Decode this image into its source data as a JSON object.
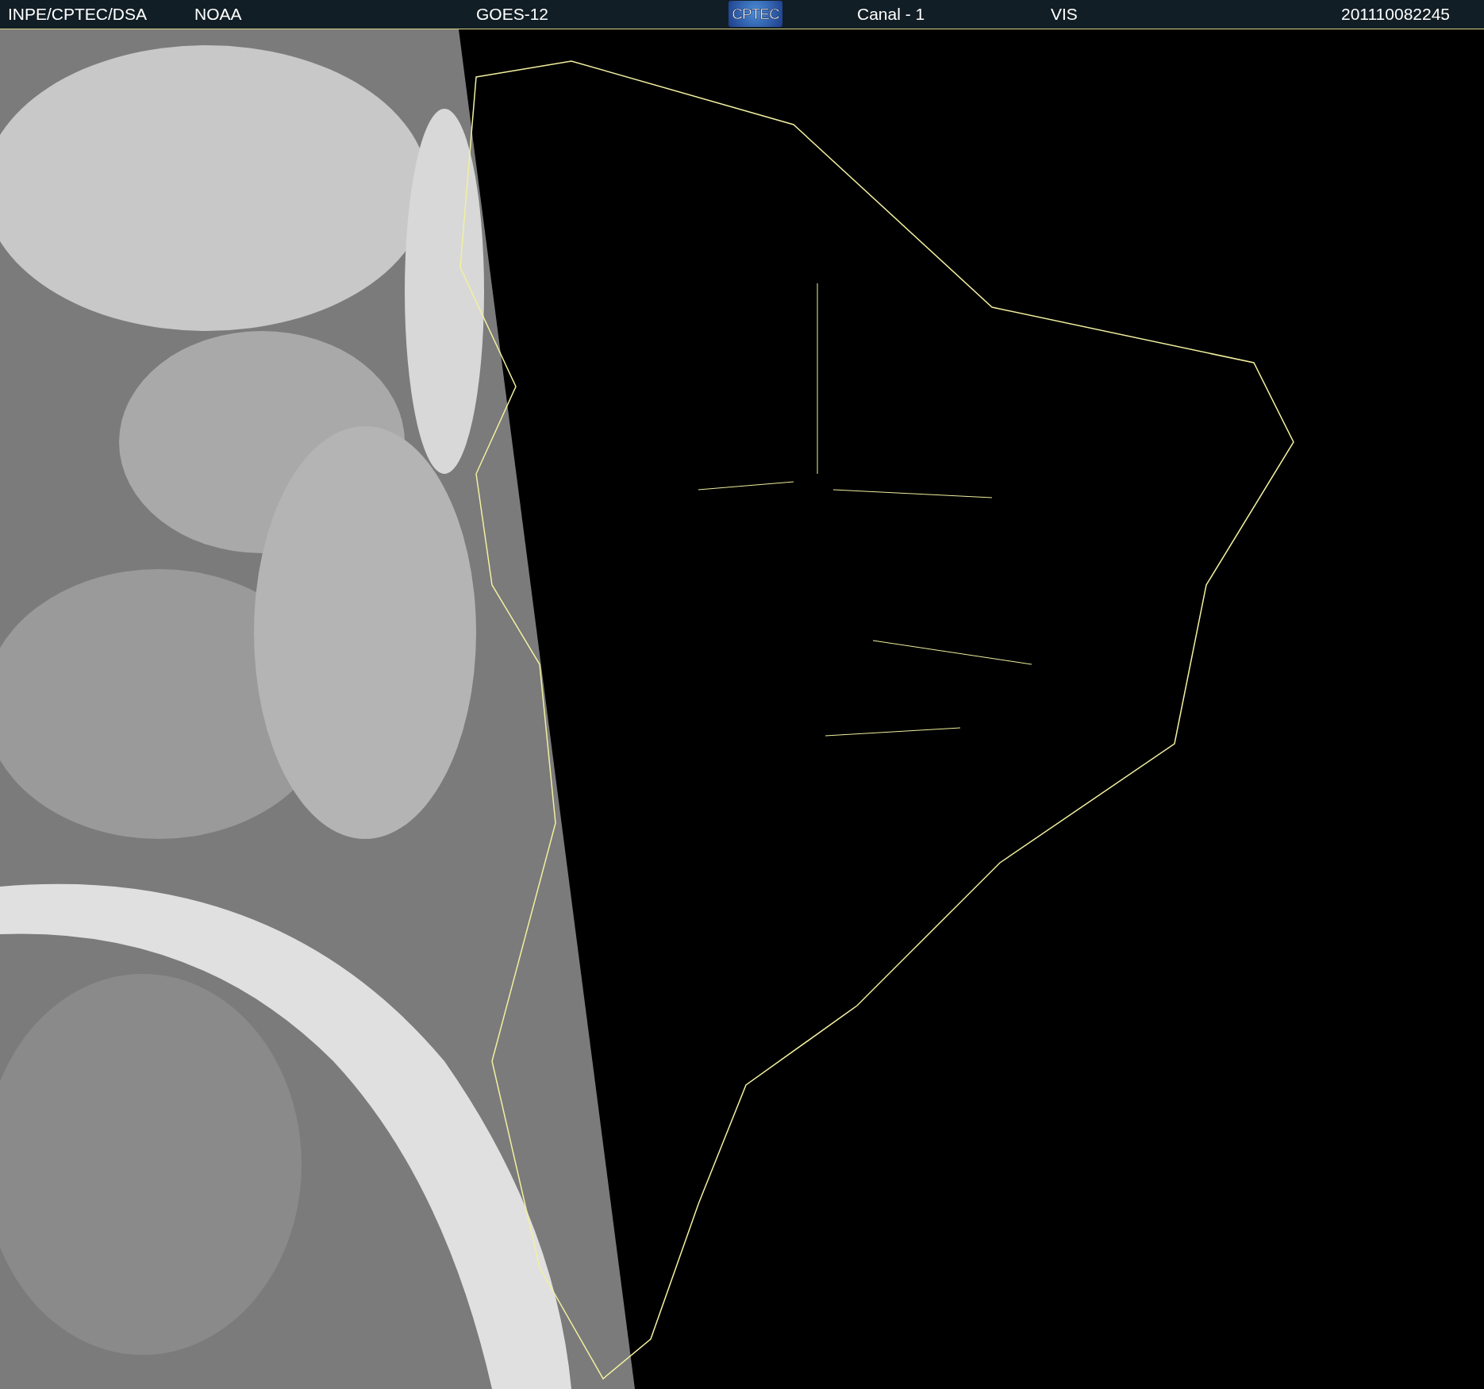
{
  "header": {
    "items": [
      {
        "kind": "text",
        "text": "INPE/CPTEC/DSA"
      },
      {
        "kind": "text",
        "text": "NOAA"
      },
      {
        "kind": "text",
        "text": "GOES-12"
      },
      {
        "kind": "logo",
        "text": "CPTEC"
      },
      {
        "kind": "text",
        "text": "Canal - 1"
      },
      {
        "kind": "text",
        "text": "VIS"
      },
      {
        "kind": "text",
        "text": "201110082245"
      }
    ]
  }
}
